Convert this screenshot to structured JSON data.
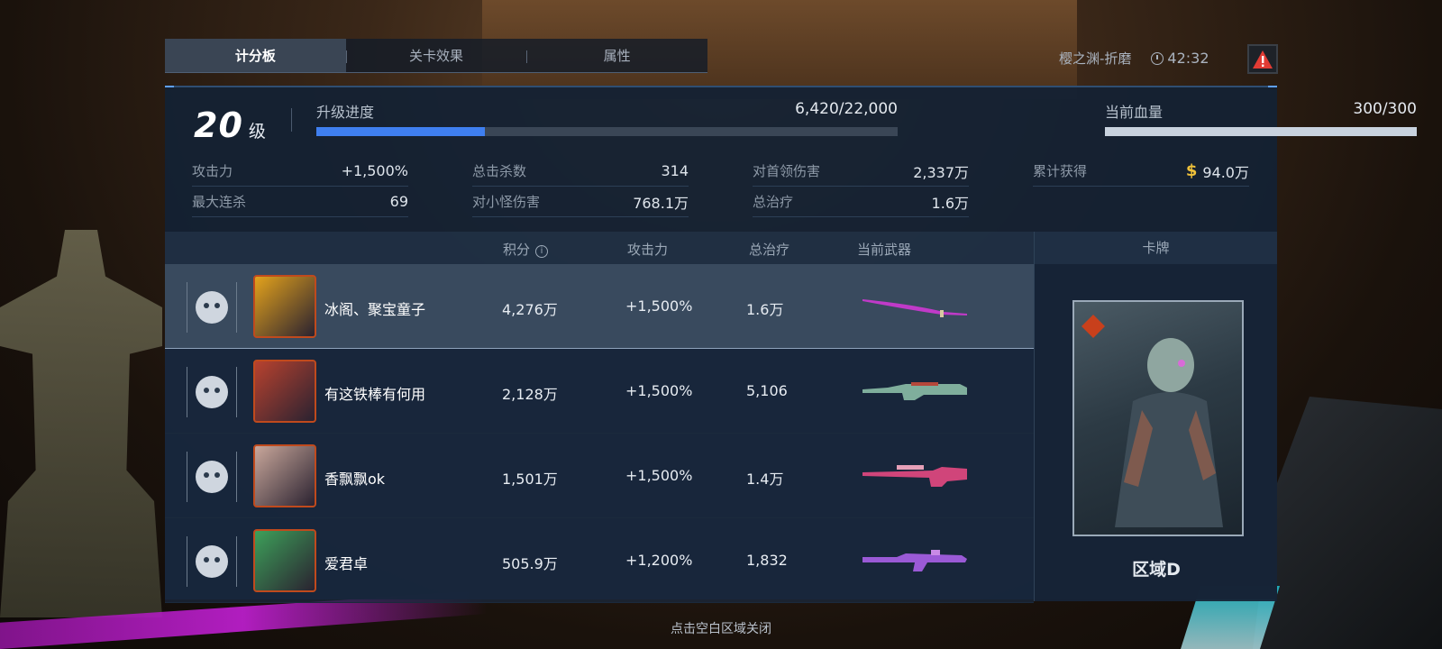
{
  "tabs": [
    {
      "label": "计分板",
      "active": true
    },
    {
      "label": "关卡效果",
      "active": false
    },
    {
      "label": "属性",
      "active": false
    }
  ],
  "map": {
    "name": "樱之渊-折磨",
    "time": "42:32"
  },
  "player": {
    "level": "20",
    "level_unit": "级",
    "xp": {
      "label": "升级进度",
      "value": "6,420/22,000",
      "progress": 0.29
    },
    "hp": {
      "label": "当前血量",
      "value": "300/300",
      "progress": 1.0
    }
  },
  "stats": [
    {
      "key": "攻击力",
      "value": "+1,500%"
    },
    {
      "key": "总击杀数",
      "value": "314"
    },
    {
      "key": "对首领伤害",
      "value": "2,337万"
    },
    {
      "key": "累计获得",
      "value": "94.0万",
      "currency": "$"
    },
    {
      "key": "最大连杀",
      "value": "69"
    },
    {
      "key": "对小怪伤害",
      "value": "768.1万"
    },
    {
      "key": "总治疗",
      "value": "1.6万"
    }
  ],
  "table": {
    "headers": {
      "score": "积分",
      "info": "i",
      "attack": "攻击力",
      "heal": "总治疗",
      "weapon": "当前武器",
      "card": "卡牌"
    },
    "rows": [
      {
        "name": "冰阁、聚宝童子",
        "score": "4,276万",
        "attack": "+1,500%",
        "heal": "1.6万",
        "icon": "monkey-face-icon",
        "self": true,
        "avatar_color": "#e3a21c",
        "weapon_color": "#c03ac8"
      },
      {
        "name": "有这铁棒有何用",
        "score": "2,128万",
        "attack": "+1,500%",
        "heal": "5,106",
        "icon": "fox-face-icon",
        "self": false,
        "avatar_color": "#b8422f",
        "weapon_color": "#7fae9c"
      },
      {
        "name": "香飘飘ok",
        "score": "1,501万",
        "attack": "+1,500%",
        "heal": "1.4万",
        "icon": "frog-face-icon",
        "self": false,
        "avatar_color": "#c9a79b",
        "weapon_color": "#d0457a"
      },
      {
        "name": "爱君卓",
        "score": "505.9万",
        "attack": "+1,200%",
        "heal": "1,832",
        "icon": "bear-face-icon",
        "self": false,
        "avatar_color": "#3da05a",
        "weapon_color": "#9a5ad6"
      }
    ]
  },
  "card": {
    "label": "区域D"
  },
  "footer": "点击空白区域关闭"
}
